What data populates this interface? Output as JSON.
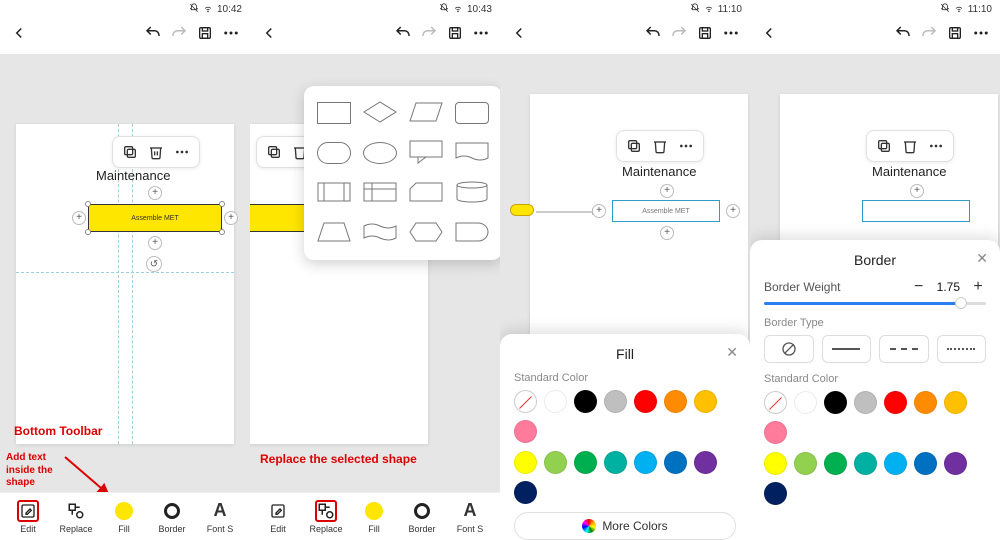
{
  "status": {
    "time1": "10:42",
    "time2": "10:43",
    "time3": "11:10",
    "time4": "11:10"
  },
  "node_label": "Maintenance",
  "shape_text": "Assemble MET",
  "bottom": {
    "edit": "Edit",
    "replace": "Replace",
    "fill": "Fill",
    "border": "Border",
    "font": "Font S"
  },
  "annotations": {
    "bottom_toolbar": "Bottom Toolbar",
    "add_text": "Add text inside the shape",
    "replace_shape": "Replace the selected shape"
  },
  "fill_sheet": {
    "title": "Fill",
    "standard": "Standard Color",
    "more": "More Colors",
    "colors_row1": [
      "none",
      "#ffffff",
      "#000000",
      "#bfbfbf",
      "#ff0000",
      "#ff8c00",
      "#ffc000",
      "#ff7b9c"
    ],
    "colors_row2": [
      "#ffff00",
      "#92d050",
      "#00b050",
      "#00b0a0",
      "#00b0f0",
      "#0070c0",
      "#7030a0",
      "#002060"
    ]
  },
  "border_sheet": {
    "title": "Border",
    "weight_label": "Border Weight",
    "weight_value": "1.75",
    "type_label": "Border Type",
    "standard": "Standard Color",
    "types": [
      "⦸",
      "———",
      "– – –",
      "·····"
    ],
    "colors_row1": [
      "none",
      "#ffffff",
      "#000000",
      "#bfbfbf",
      "#ff0000",
      "#ff8c00",
      "#ffc000",
      "#ff7b9c"
    ],
    "colors_row2": [
      "#ffff00",
      "#92d050",
      "#00b050",
      "#00b0a0",
      "#00b0f0",
      "#0070c0",
      "#7030a0",
      "#002060"
    ]
  }
}
